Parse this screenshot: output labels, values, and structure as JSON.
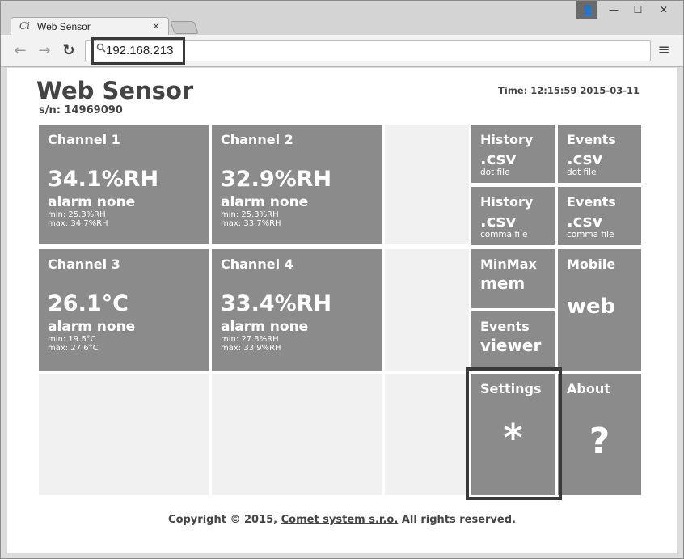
{
  "browser": {
    "tab_title": "Web Sensor",
    "tab_favicon": "Ci",
    "tab_close": "×",
    "address": "192.168.213",
    "icons": {
      "back": "←",
      "forward": "→",
      "reload": "↻",
      "menu": "≡",
      "search": "🔍",
      "user": "👤",
      "minimize": "—",
      "maximize": "☐",
      "close": "✕"
    }
  },
  "header": {
    "title": "Web Sensor",
    "serial": "s/n: 14969090",
    "time": "Time: 12:15:59 2015-03-11"
  },
  "channels": [
    {
      "title": "Channel 1",
      "value": "34.1%RH",
      "alarm": "alarm none",
      "min": "min: 25.3%RH",
      "max": "max: 34.7%RH"
    },
    {
      "title": "Channel 2",
      "value": "32.9%RH",
      "alarm": "alarm none",
      "min": "min: 25.3%RH",
      "max": "max: 33.7%RH"
    },
    {
      "title": "Channel 3",
      "value": "26.1°C",
      "alarm": "alarm none",
      "min": "min: 19.6°C",
      "max": "max: 27.6°C"
    },
    {
      "title": "Channel 4",
      "value": "33.4%RH",
      "alarm": "alarm none",
      "min": "min: 27.3%RH",
      "max": "max: 33.9%RH"
    }
  ],
  "side_tiles": {
    "history_dot": {
      "title": "History",
      "big": ".csv",
      "sub": "dot file"
    },
    "events_dot": {
      "title": "Events",
      "big": ".csv",
      "sub": "dot file"
    },
    "history_comma": {
      "title": "History",
      "big": ".csv",
      "sub": "comma file"
    },
    "events_comma": {
      "title": "Events",
      "big": ".csv",
      "sub": "comma file"
    },
    "minmax": {
      "title": "MinMax",
      "big": "mem"
    },
    "mobile": {
      "title": "Mobile",
      "big": "web"
    },
    "events_viewer": {
      "title": "Events",
      "big": "viewer"
    },
    "settings": {
      "title": "Settings",
      "symbol": "*"
    },
    "about": {
      "title": "About",
      "symbol": "?"
    }
  },
  "footer": {
    "prefix": "Copyright © 2015, ",
    "link": "Comet system s.r.o.",
    "suffix": " All rights reserved."
  }
}
